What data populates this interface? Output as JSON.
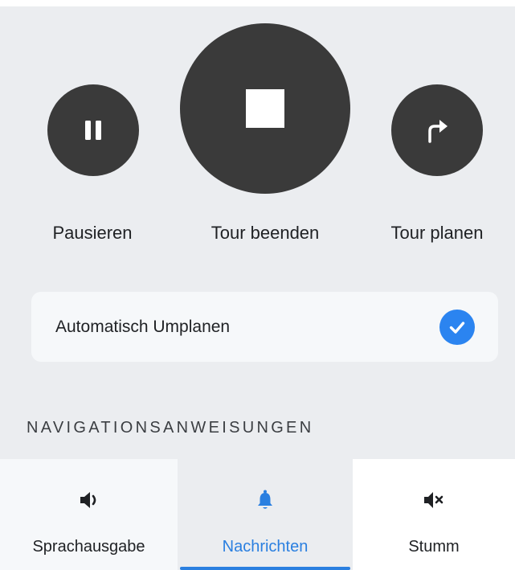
{
  "actions": {
    "pause": {
      "label": "Pausieren",
      "icon": "pause-icon"
    },
    "stop": {
      "label": "Tour beenden",
      "icon": "stop-icon"
    },
    "plan": {
      "label": "Tour planen",
      "icon": "turn-right-arrow-icon"
    }
  },
  "settings": {
    "auto_replan": {
      "label": "Automatisch Umplanen",
      "checked": true,
      "icon": "checkmark-icon"
    }
  },
  "navigation": {
    "heading": "NAVIGATIONSANWEISUNGEN",
    "options": [
      {
        "label": "Sprachausgabe",
        "icon": "speaker-icon",
        "selected": false
      },
      {
        "label": "Nachrichten",
        "icon": "bell-icon",
        "selected": true
      },
      {
        "label": "Stumm",
        "icon": "mute-icon",
        "selected": false
      }
    ]
  },
  "colors": {
    "accent": "#2a7fe0",
    "button": "#3a3a3a",
    "background": "#ebedf0",
    "card": "#f6f8fa"
  }
}
